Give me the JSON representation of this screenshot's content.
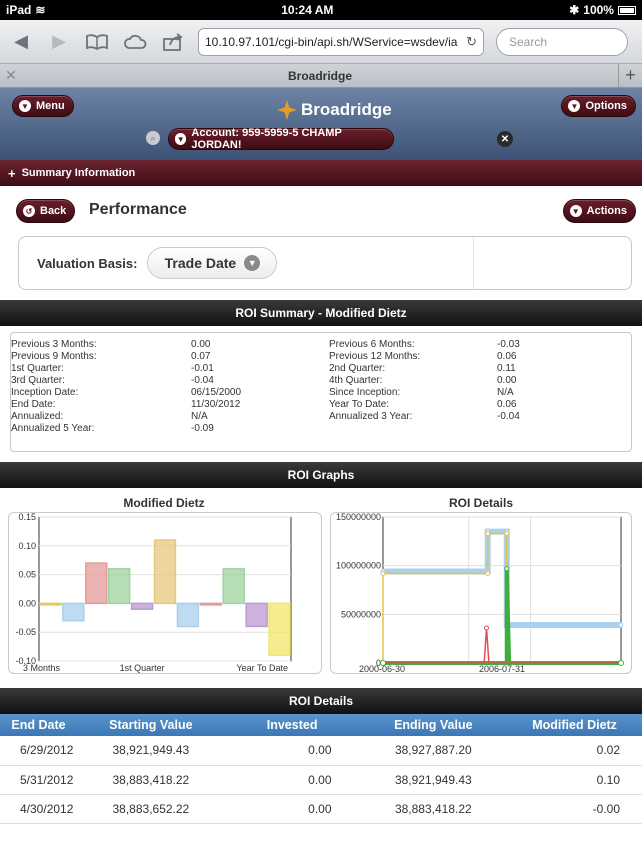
{
  "status": {
    "device": "iPad",
    "time": "10:24 AM",
    "battery": "100%"
  },
  "browser": {
    "url": "10.10.97.101/cgi-bin/api.sh/WService=wsdev/ia",
    "search_placeholder": "Search",
    "tab_title": "Broadridge"
  },
  "app": {
    "menu_label": "Menu",
    "options_label": "Options",
    "brand": "Broadridge",
    "account": "Account: 959-5959-5 CHAMP JORDAN!",
    "summary_label": "Summary Information"
  },
  "page": {
    "back_label": "Back",
    "title": "Performance",
    "actions_label": "Actions",
    "valuation_label": "Valuation Basis:",
    "valuation_value": "Trade Date"
  },
  "roi_summary": {
    "title": "ROI Summary - Modified Dietz",
    "left": [
      {
        "label": "Previous 3 Months:",
        "value": "0.00"
      },
      {
        "label": "Previous 9 Months:",
        "value": "0.07"
      },
      {
        "label": "1st Quarter:",
        "value": "-0.01"
      },
      {
        "label": "3rd Quarter:",
        "value": "-0.04"
      },
      {
        "label": "Inception Date:",
        "value": "06/15/2000"
      },
      {
        "label": "End Date:",
        "value": "11/30/2012"
      },
      {
        "label": "Annualized:",
        "value": "N/A"
      },
      {
        "label": "Annualized 5 Year:",
        "value": "-0.09"
      }
    ],
    "right": [
      {
        "label": "Previous 6 Months:",
        "value": "-0.03"
      },
      {
        "label": "Previous 12 Months:",
        "value": "0.06"
      },
      {
        "label": "2nd Quarter:",
        "value": "0.11"
      },
      {
        "label": "4th Quarter:",
        "value": "0.00"
      },
      {
        "label": "Since Inception:",
        "value": "N/A"
      },
      {
        "label": "Year To Date:",
        "value": "0.06"
      },
      {
        "label": "Annualized 3 Year:",
        "value": "-0.04"
      }
    ]
  },
  "graphs": {
    "section_title": "ROI Graphs",
    "left_title": "Modified Dietz",
    "right_title": "ROI Details",
    "left_ticks": [
      "0.15",
      "0.10",
      "0.05",
      "0.00",
      "-0.05",
      "-0.10"
    ],
    "left_xlabels": [
      "3 Months",
      "1st Quarter",
      "Year To Date"
    ],
    "right_ticks": [
      "150000000",
      "100000000",
      "50000000",
      "0"
    ],
    "right_xlabels": [
      "2000-06-30",
      "2006-07-31"
    ]
  },
  "chart_data": [
    {
      "type": "bar",
      "title": "Modified Dietz",
      "ylim": [
        -0.1,
        0.15
      ],
      "categories": [
        "Previous 3 Months",
        "Previous 6 Months",
        "Previous 9 Months",
        "Previous 12 Months",
        "1st Quarter",
        "2nd Quarter",
        "3rd Quarter",
        "4th Quarter",
        "Year To Date",
        "Annualized 3 Year",
        "Annualized 5 Year"
      ],
      "values": [
        0.0,
        -0.03,
        0.07,
        0.06,
        -0.01,
        0.11,
        -0.04,
        0.0,
        0.06,
        -0.04,
        -0.09
      ],
      "colors": [
        "#e8c85a",
        "#a9cfee",
        "#e59a9a",
        "#9fd39f",
        "#b99ad2",
        "#e6c87c",
        "#a9cfee",
        "#e59a9a",
        "#9fd39f",
        "#b99ad2",
        "#f1e66a"
      ],
      "x_tick_labels": [
        "3 Months",
        "1st Quarter",
        "Year To Date"
      ]
    },
    {
      "type": "line",
      "title": "ROI Details",
      "ylim": [
        0,
        150000000
      ],
      "x_tick_labels": [
        "2000-06-30",
        "2006-07-31"
      ],
      "series": [
        {
          "color": "#a9d0ee",
          "points": [
            [
              0,
              94
            ],
            [
              0.44,
              94
            ],
            [
              0.44,
              135
            ],
            [
              0.52,
              135
            ],
            [
              0.52,
              39
            ],
            [
              1,
              39
            ]
          ]
        },
        {
          "color": "#e8c33e",
          "points": [
            [
              0,
              0
            ],
            [
              0,
              92
            ],
            [
              0.44,
              92
            ],
            [
              0.44,
              133
            ],
            [
              0.52,
              133
            ],
            [
              0.52,
              0
            ],
            [
              1,
              0
            ]
          ]
        },
        {
          "color": "#3fae3f",
          "points": [
            [
              0,
              0
            ],
            [
              0.52,
              0
            ],
            [
              0.52,
              97
            ],
            [
              0.53,
              0
            ],
            [
              1,
              0
            ]
          ]
        },
        {
          "color": "#e05050",
          "points": [
            [
              0,
              0
            ],
            [
              0.425,
              0
            ],
            [
              0.435,
              36
            ],
            [
              0.445,
              0
            ],
            [
              1,
              0
            ]
          ]
        }
      ]
    }
  ],
  "details": {
    "title": "ROI Details",
    "columns": [
      "End Date",
      "Starting Value",
      "Invested",
      "Ending Value",
      "Modified Dietz"
    ],
    "rows": [
      [
        "6/29/2012",
        "38,921,949.43",
        "0.00",
        "38,927,887.20",
        "0.02"
      ],
      [
        "5/31/2012",
        "38,883,418.22",
        "0.00",
        "38,921,949.43",
        "0.10"
      ],
      [
        "4/30/2012",
        "38,883,652.22",
        "0.00",
        "38,883,418.22",
        "-0.00"
      ]
    ]
  }
}
